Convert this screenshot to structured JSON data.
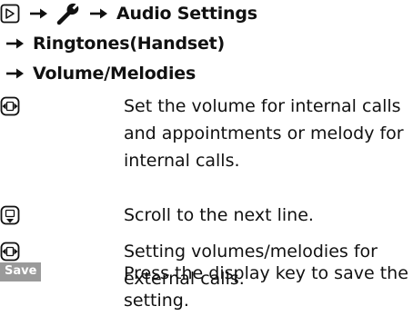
{
  "path": {
    "line1": "Audio Settings",
    "line2": "Ringtones(Handset)",
    "line3": "Volume/Melodies"
  },
  "steps": [
    {
      "icon": "control-key-left-right-icon",
      "text": "Set the volume for internal calls and appointments or melody for internal calls."
    },
    {
      "icon": "control-key-down-icon",
      "text": "Scroll to the next line."
    },
    {
      "icon": "control-key-left-right-icon",
      "text": "Setting volumes/melodies for external calls."
    },
    {
      "key_label": "Save",
      "text": "Press the display key to save the setting."
    }
  ],
  "colors": {
    "text": "#111111",
    "display_key_bg": "#9a9a9a",
    "display_key_text": "#ffffff"
  }
}
